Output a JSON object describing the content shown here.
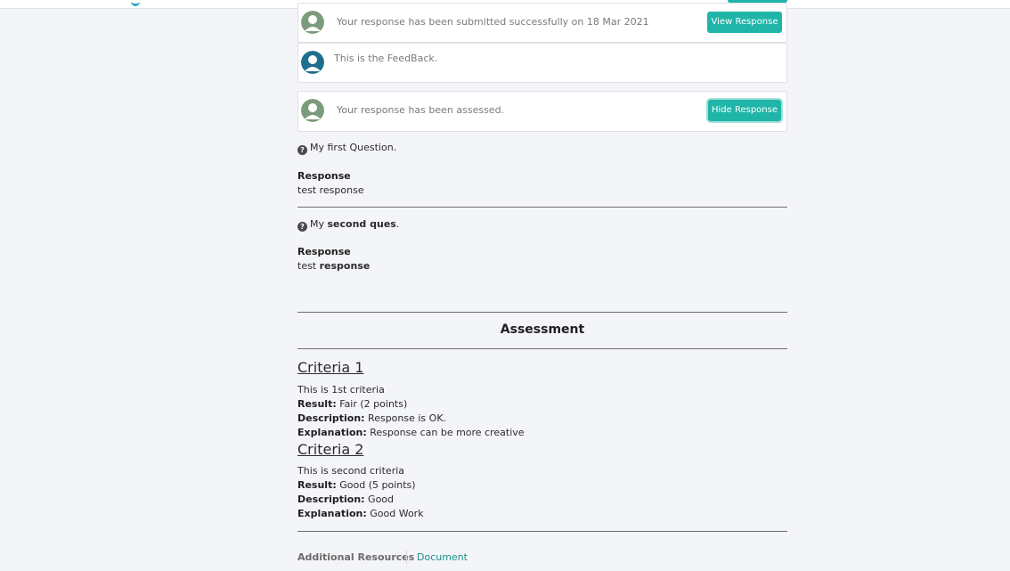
{
  "colors": {
    "accent": "#1fb5a8",
    "avatar_green": "#7c9b7a",
    "avatar_teal": "#1e6f8c",
    "link": "#1a8f86"
  },
  "submission_card": {
    "message": "Your response has been submitted successfully on 18 Mar 2021",
    "button": "View Response",
    "avatar_icon": "user-avatar-icon"
  },
  "feedback_card": {
    "message": "This is the FeedBack.",
    "avatar_icon": "user-avatar-icon"
  },
  "assessed_card": {
    "message": "Your response has been assessed.",
    "button": "Hide Response",
    "avatar_icon": "user-avatar-icon"
  },
  "questions": [
    {
      "text": "My first Question.",
      "response_label": "Response",
      "response": "test response"
    },
    {
      "text_prefix": "My ",
      "text_bold": "second ques",
      "text_suffix": ".",
      "response_label": "Response",
      "response_prefix": "test ",
      "response_bold": "response"
    }
  ],
  "assessment": {
    "title": "Assessment",
    "criteria": [
      {
        "title": "Criteria 1",
        "desc": "This is 1st criteria",
        "result_label": "Result:",
        "result": "Fair (2 points)",
        "description_label": "Description:",
        "description": "Response is OK.",
        "explanation_label": "Explanation:",
        "explanation": "Response can be more creative"
      },
      {
        "title": "Criteria 2",
        "desc": "This is second criteria",
        "result_label": "Result:",
        "result": "Good (5 points)",
        "description_label": "Description:",
        "description": "Good",
        "explanation_label": "Explanation:",
        "explanation": "Good Work"
      }
    ]
  },
  "additional_resources": {
    "label": "Additional Resources",
    "link": "Document"
  }
}
